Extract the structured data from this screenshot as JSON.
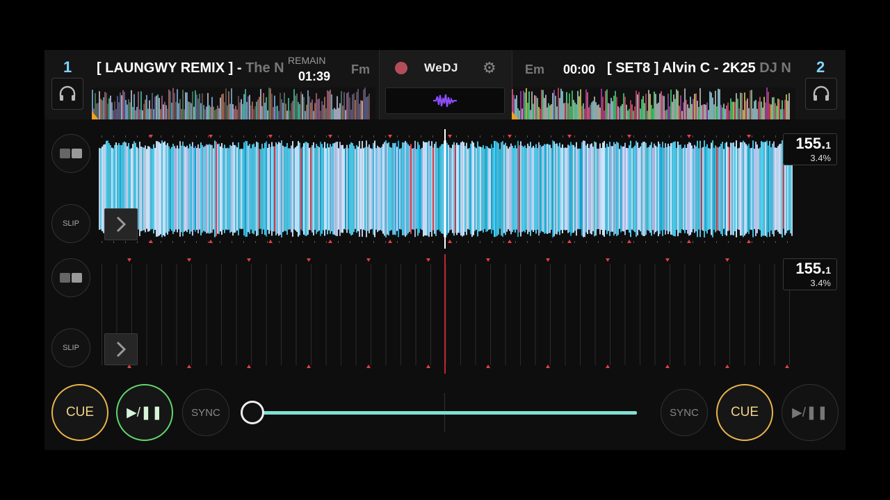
{
  "app": {
    "logo": "WeDJ"
  },
  "deck1": {
    "number": "1",
    "title_main": "[ LAUNGWY REMIX ] -",
    "title_rest": " The N",
    "remain_label": "REMAIN",
    "remain_time": "01:39",
    "key": "Fm",
    "bpm_int": "155.",
    "bpm_dec": "1",
    "pitch": "3.4%",
    "slip_label": "SLIP",
    "cue_label": "CUE",
    "play_label": "▶/❚❚",
    "sync_label": "SYNC"
  },
  "deck2": {
    "number": "2",
    "key": "Em",
    "time": "00:00",
    "title_main": "[ SET8 ] Alvin C  - 2K25",
    "title_rest": " DJ N",
    "bpm_int": "155.",
    "bpm_dec": "1",
    "pitch": "3.4%",
    "slip_label": "SLIP",
    "cue_label": "CUE",
    "play_label": "▶/❚❚",
    "sync_label": "SYNC"
  },
  "crossfader": {
    "position": 0.0
  },
  "colors": {
    "cue": "#e8b54c",
    "play": "#62d66c",
    "deck_number": "#7ed6ff",
    "crossfader": "#7ee0d4",
    "record": "#b44d5b",
    "beat_marker": "#e0404a"
  }
}
